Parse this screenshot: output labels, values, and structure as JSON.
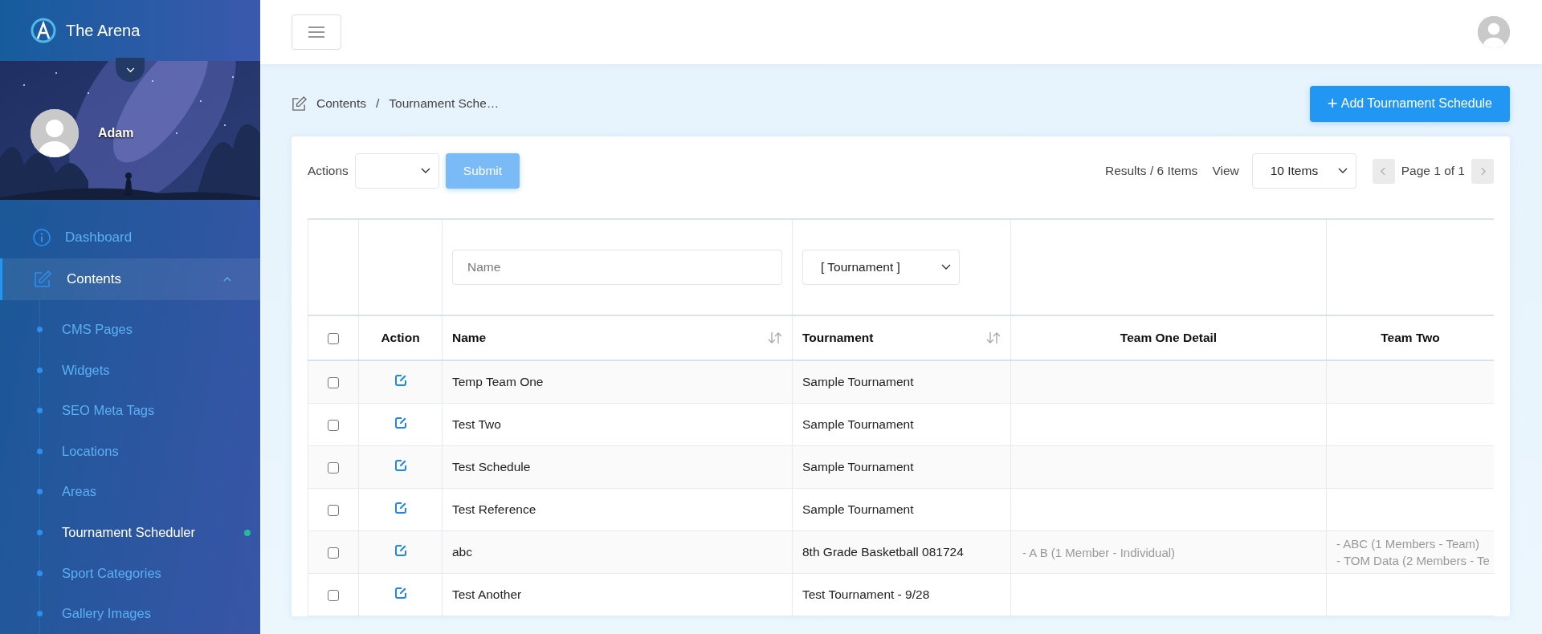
{
  "sidebar": {
    "brand": "The Arena",
    "user": {
      "name": "Adam"
    },
    "items": [
      {
        "label": "Dashboard",
        "kind": "info",
        "selected": false
      },
      {
        "label": "Contents",
        "kind": "edit",
        "selected": true,
        "expanded": true,
        "children": [
          {
            "label": "CMS Pages",
            "selected": false
          },
          {
            "label": "Widgets",
            "selected": false
          },
          {
            "label": "SEO Meta Tags",
            "selected": false
          },
          {
            "label": "Locations",
            "selected": false
          },
          {
            "label": "Areas",
            "selected": false
          },
          {
            "label": "Tournament Scheduler",
            "selected": true
          },
          {
            "label": "Sport Categories",
            "selected": false
          },
          {
            "label": "Gallery Images",
            "selected": false
          }
        ]
      }
    ]
  },
  "breadcrumb": {
    "separator": "/",
    "items": [
      "Contents",
      "Tournament Sche…"
    ]
  },
  "add_button": {
    "icon": "+",
    "label": "Add Tournament Schedule"
  },
  "toolbar": {
    "actions_label": "Actions",
    "submit": {
      "label": "Submit",
      "disabled": true
    },
    "results": "Results / 6 Items",
    "view_label": "View",
    "view_select": "10 Items",
    "pager": {
      "label": "Page 1 of 1",
      "prev_disabled": true,
      "next_disabled": true
    }
  },
  "table": {
    "filters": {
      "name": {
        "placeholder": "Name"
      },
      "tournament": {
        "value": "[ Tournament ]"
      }
    },
    "select_all": {
      "checked": false
    },
    "columns": [
      {
        "label": "Action"
      },
      {
        "label": "Name",
        "sortable": true
      },
      {
        "label": "Tournament",
        "sortable": true
      },
      {
        "label": "Team One Detail"
      },
      {
        "label": "Team Two"
      }
    ],
    "rows": [
      {
        "checked": false,
        "name": "Temp Team One",
        "tournament": "Sample Tournament"
      },
      {
        "checked": false,
        "name": "Test Two",
        "tournament": "Sample Tournament"
      },
      {
        "checked": false,
        "name": "Test Schedule",
        "tournament": "Sample Tournament"
      },
      {
        "checked": false,
        "name": "Test Reference",
        "tournament": "Sample Tournament"
      },
      {
        "checked": false,
        "name": "abc",
        "tournament": "8th Grade Basketball 081724",
        "team_one": [
          "- A B (1 Member - Individual)"
        ],
        "team_two": [
          "- ABC (1 Members - Team)",
          "- TOM Data (2 Members - Te"
        ]
      },
      {
        "checked": false,
        "name": "Test Another",
        "tournament": "Test Tournament - 9/28"
      }
    ]
  }
}
